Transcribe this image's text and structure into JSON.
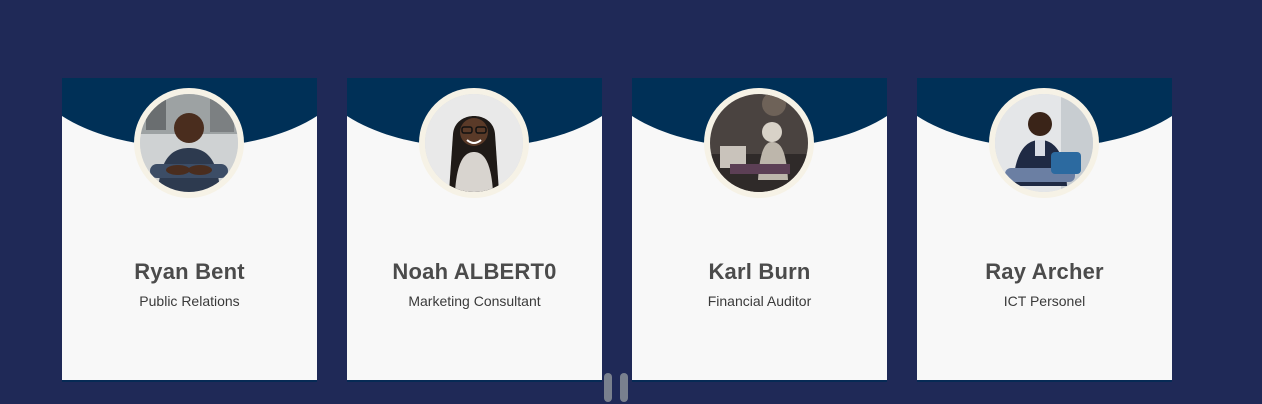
{
  "theme": {
    "background": "#1f2957",
    "card_header": "#003057",
    "card_body": "#f8f8f8",
    "avatar_ring": "#f6f2e6"
  },
  "team": [
    {
      "name": "Ryan Bent",
      "role": "Public Relations",
      "photo_icon": "person-photo"
    },
    {
      "name": "Noah ALBERT0",
      "role": "Marketing Consultant",
      "photo_icon": "person-photo"
    },
    {
      "name": "Karl Burn",
      "role": "Financial Auditor",
      "photo_icon": "person-photo"
    },
    {
      "name": "Ray Archer",
      "role": "ICT Personel",
      "photo_icon": "person-photo"
    }
  ],
  "carousel": {
    "page_count": 2,
    "current_page": 1
  }
}
